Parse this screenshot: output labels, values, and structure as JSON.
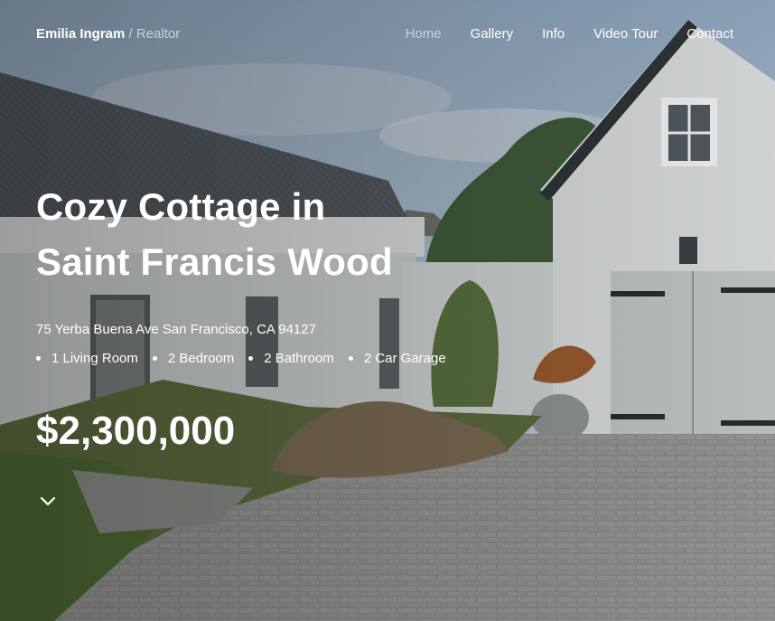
{
  "header": {
    "agent_name": "Emilia Ingram",
    "separator": "/",
    "agent_role": "Realtor"
  },
  "nav": {
    "items": [
      {
        "label": "Home",
        "active": true
      },
      {
        "label": "Gallery",
        "active": false
      },
      {
        "label": "Info",
        "active": false
      },
      {
        "label": "Video Tour",
        "active": false
      },
      {
        "label": "Contact",
        "active": false
      }
    ]
  },
  "listing": {
    "title_line1": "Cozy Cottage in",
    "title_line2": "Saint Francis Wood",
    "address": "75 Yerba Buena Ave San Francisco, CA 94127",
    "features": [
      "1 Living Room",
      "2 Bedroom",
      "2 Bathroom",
      "2 Car Garage"
    ],
    "price": "$2,300,000"
  },
  "icons": {
    "scroll_down": "chevron-down-icon"
  }
}
